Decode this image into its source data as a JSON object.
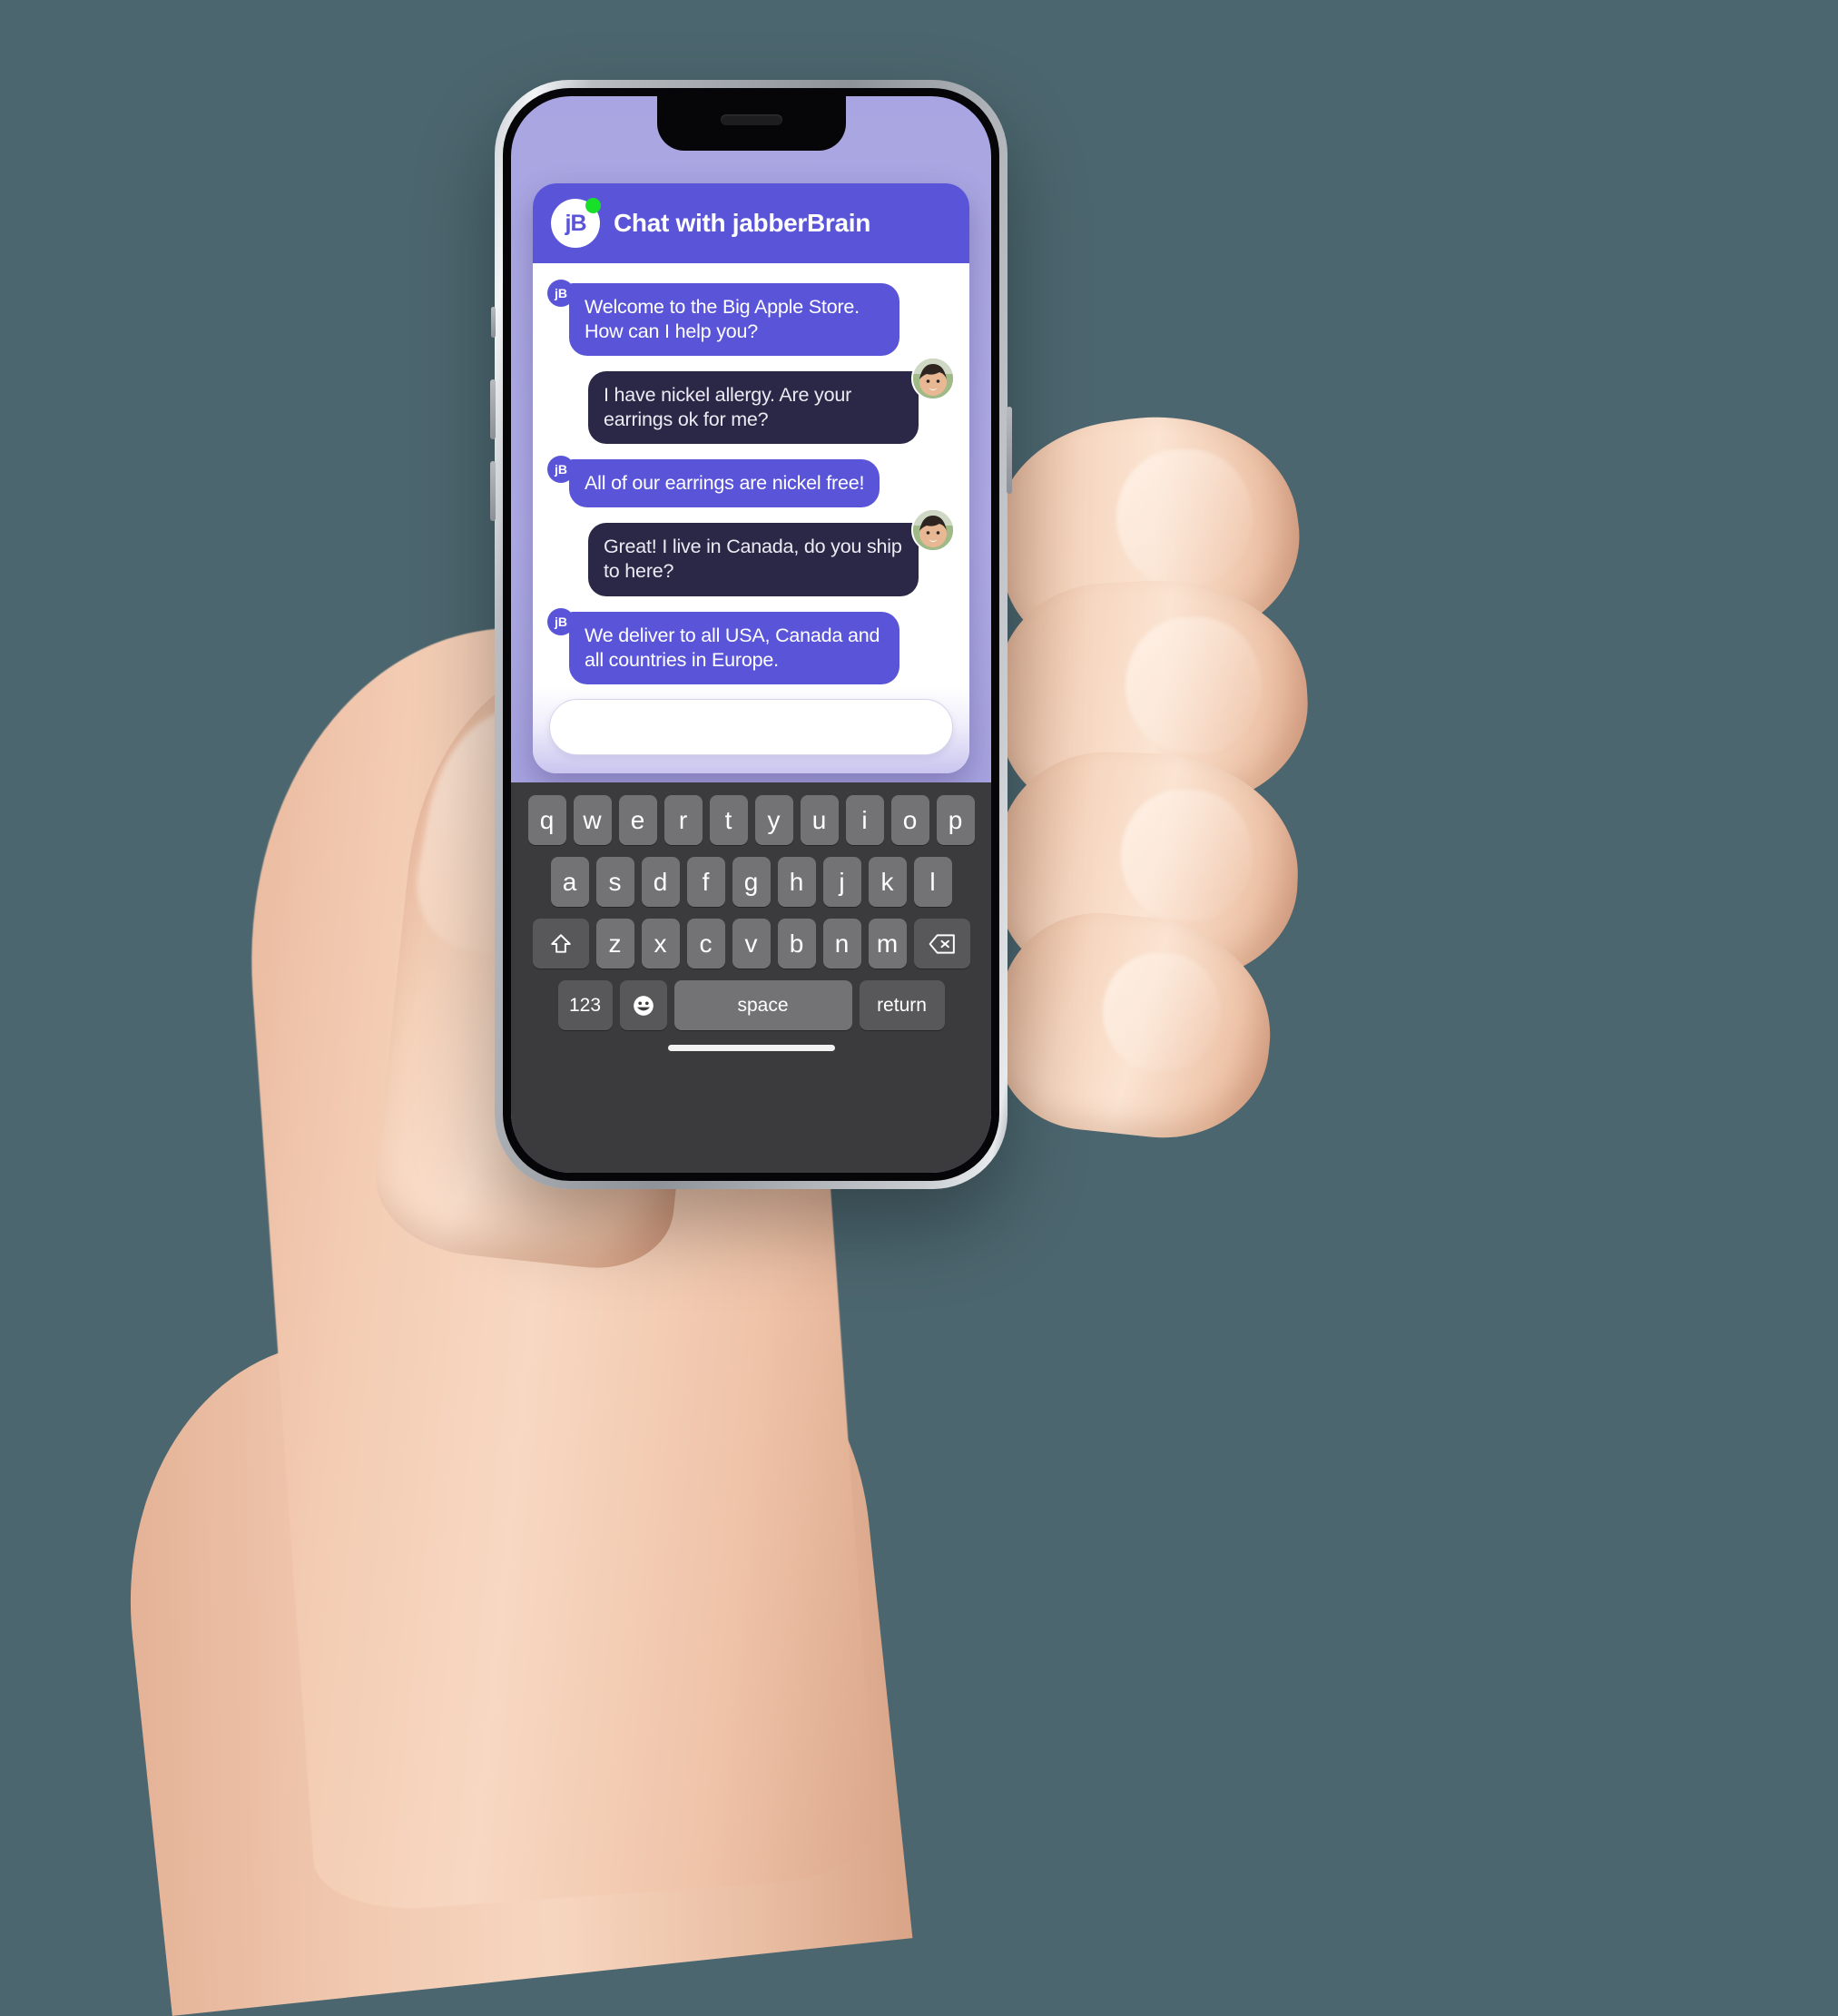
{
  "background": {
    "color": "#4c666f"
  },
  "device": {
    "name": "smartphone-mockup",
    "frame_color": "#b9bdc2",
    "screen_bg": "#a9a5e2"
  },
  "chat_widget": {
    "header": {
      "avatar_initials": "jB",
      "title": "Chat with jabberBrain",
      "status": "online",
      "status_color": "#18e02a",
      "bg_color": "#5a55d8"
    },
    "messages": [
      {
        "sender": "bot",
        "avatar_initials": "jB",
        "text": "Welcome to the Big Apple Store. How can I help you?"
      },
      {
        "sender": "user",
        "avatar_initials": "",
        "text": "I have nickel allergy. Are your earrings ok for me?"
      },
      {
        "sender": "bot",
        "avatar_initials": "jB",
        "text": "All of our earrings are nickel free!"
      },
      {
        "sender": "user",
        "avatar_initials": "",
        "text": "Great! I live in Canada, do you ship to here?"
      },
      {
        "sender": "bot",
        "avatar_initials": "jB",
        "text": "We deliver to all USA, Canada and all countries in Europe."
      }
    ],
    "colors": {
      "bot_bubble": "#5a55d8",
      "user_bubble": "#2b2747",
      "bubble_text": "#ffffff"
    },
    "input": {
      "value": "",
      "placeholder": ""
    }
  },
  "keyboard": {
    "row1": [
      "q",
      "w",
      "e",
      "r",
      "t",
      "y",
      "u",
      "i",
      "o",
      "p"
    ],
    "row2": [
      "a",
      "s",
      "d",
      "f",
      "g",
      "h",
      "j",
      "k",
      "l"
    ],
    "row3": [
      "z",
      "x",
      "c",
      "v",
      "b",
      "n",
      "m"
    ],
    "shift_icon": "shift-arrow-icon",
    "backspace_icon": "backspace-icon",
    "numbers_key": "123",
    "emoji_key": "emoji-icon",
    "space_key": "space",
    "return_key": "return"
  }
}
